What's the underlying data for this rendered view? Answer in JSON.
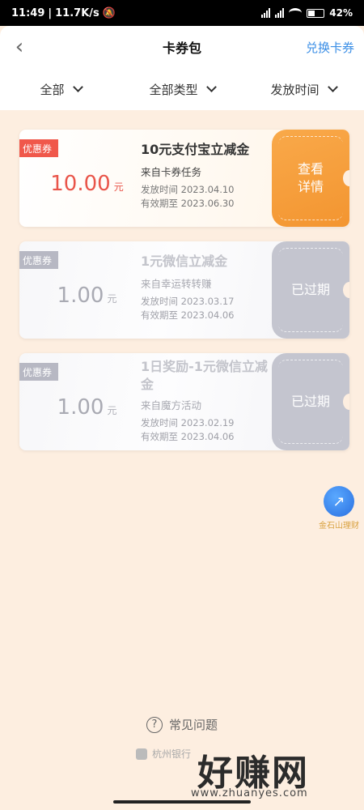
{
  "status": {
    "time": "11:49",
    "speed": "11.7K/s",
    "battery": "42%"
  },
  "header": {
    "back_icon": "chevron-left-icon",
    "title": "卡券包",
    "exchange": "兑换卡券"
  },
  "filters": [
    {
      "label": "全部"
    },
    {
      "label": "全部类型"
    },
    {
      "label": "发放时间"
    }
  ],
  "coupons": [
    {
      "badge": "优惠券",
      "amount": "10.00",
      "unit": "元",
      "title": "10元支付宝立减金",
      "source": "来自卡券任务",
      "issued": "发放时间 2023.04.10",
      "valid": "有效期至 2023.06.30",
      "action": "查看详情",
      "status": "active"
    },
    {
      "badge": "优惠券",
      "amount": "1.00",
      "unit": "元",
      "title": "1元微信立减金",
      "source": "来自幸运转转赚",
      "issued": "发放时间 2023.03.17",
      "valid": "有效期至 2023.04.06",
      "action": "已过期",
      "status": "expired"
    },
    {
      "badge": "优惠券",
      "amount": "1.00",
      "unit": "元",
      "title": "1日奖励-1元微信立减金",
      "source": "来自魔方活动",
      "issued": "发放时间 2023.02.19",
      "valid": "有效期至 2023.04.06",
      "action": "已过期",
      "status": "expired"
    }
  ],
  "float_button": {
    "label": "金石山理财"
  },
  "footer": {
    "faq": "常见问题",
    "bank": "杭州银行"
  },
  "watermark": {
    "main": "好赚网",
    "url": "www.zhuanyes.com"
  },
  "colors": {
    "accent": "#3a8ee6",
    "active_stub": "#f39530",
    "badge_active": "#f0584b",
    "expired": "#c4c5cf",
    "page_bg": "#fdeee0"
  }
}
